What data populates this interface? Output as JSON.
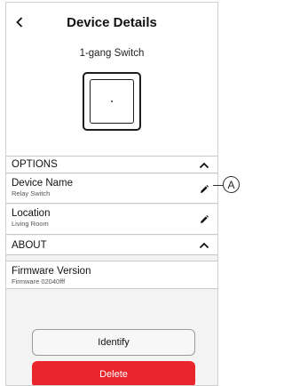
{
  "header": {
    "title": "Device Details",
    "device_type": "1-gang Switch"
  },
  "icons": {
    "back": "chevron-left-icon",
    "collapse": "chevron-up-icon",
    "edit": "pencil-icon"
  },
  "options": {
    "label": "OPTIONS",
    "items": [
      {
        "title": "Device Name",
        "value": "Relay Switch"
      },
      {
        "title": "Location",
        "value": "Living Room"
      }
    ]
  },
  "about": {
    "label": "ABOUT",
    "items": [
      {
        "title": "Firmware Version",
        "value": "Firmware 02040fff"
      }
    ]
  },
  "buttons": {
    "identify": "Identify",
    "delete": "Delete"
  },
  "callout": {
    "label": "A"
  },
  "colors": {
    "background": "#f3f3f3",
    "danger": "#e9242b",
    "divider": "#c8c8c8"
  }
}
